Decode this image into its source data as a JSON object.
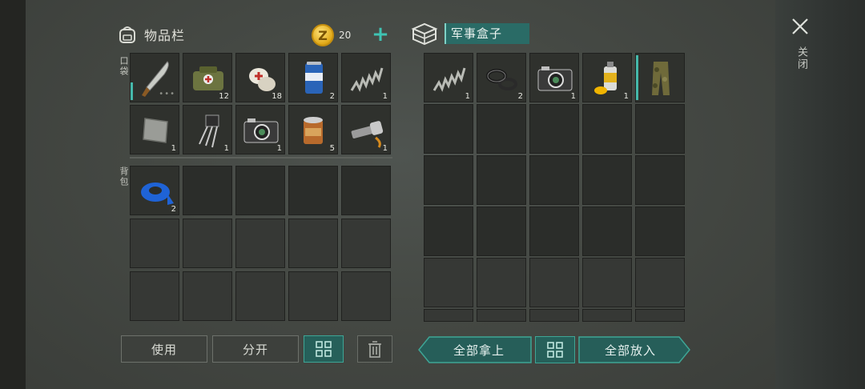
{
  "inventory": {
    "title": "物品栏",
    "coins": "20",
    "pocket_label": "口袋",
    "backpack_label": "背包",
    "pocket_items": [
      {
        "name": "machete",
        "qty": ""
      },
      {
        "name": "first-aid-bag",
        "qty": "12"
      },
      {
        "name": "bandage",
        "qty": "18"
      },
      {
        "name": "soda-can",
        "qty": "2"
      },
      {
        "name": "spring",
        "qty": "1"
      },
      {
        "name": "metal-plate",
        "qty": "1"
      },
      {
        "name": "transistor",
        "qty": "1"
      },
      {
        "name": "camera",
        "qty": "1"
      },
      {
        "name": "tin-can",
        "qty": "5"
      },
      {
        "name": "flashlight",
        "qty": "1"
      }
    ],
    "backpack_items": [
      {
        "name": "duct-tape",
        "qty": "2"
      }
    ]
  },
  "container": {
    "title": "军事盒子",
    "items": [
      {
        "name": "spring",
        "qty": "1"
      },
      {
        "name": "washers",
        "qty": "2"
      },
      {
        "name": "camera",
        "qty": "1"
      },
      {
        "name": "spray-can",
        "qty": "1"
      },
      {
        "name": "camo-pants",
        "qty": ""
      }
    ]
  },
  "close_label": "关闭",
  "buttons": {
    "use": "使用",
    "split": "分开",
    "take_all": "全部拿上",
    "put_all": "全部放入"
  },
  "colors": {
    "accent": "#3ea595",
    "coin": "#e0a817"
  }
}
